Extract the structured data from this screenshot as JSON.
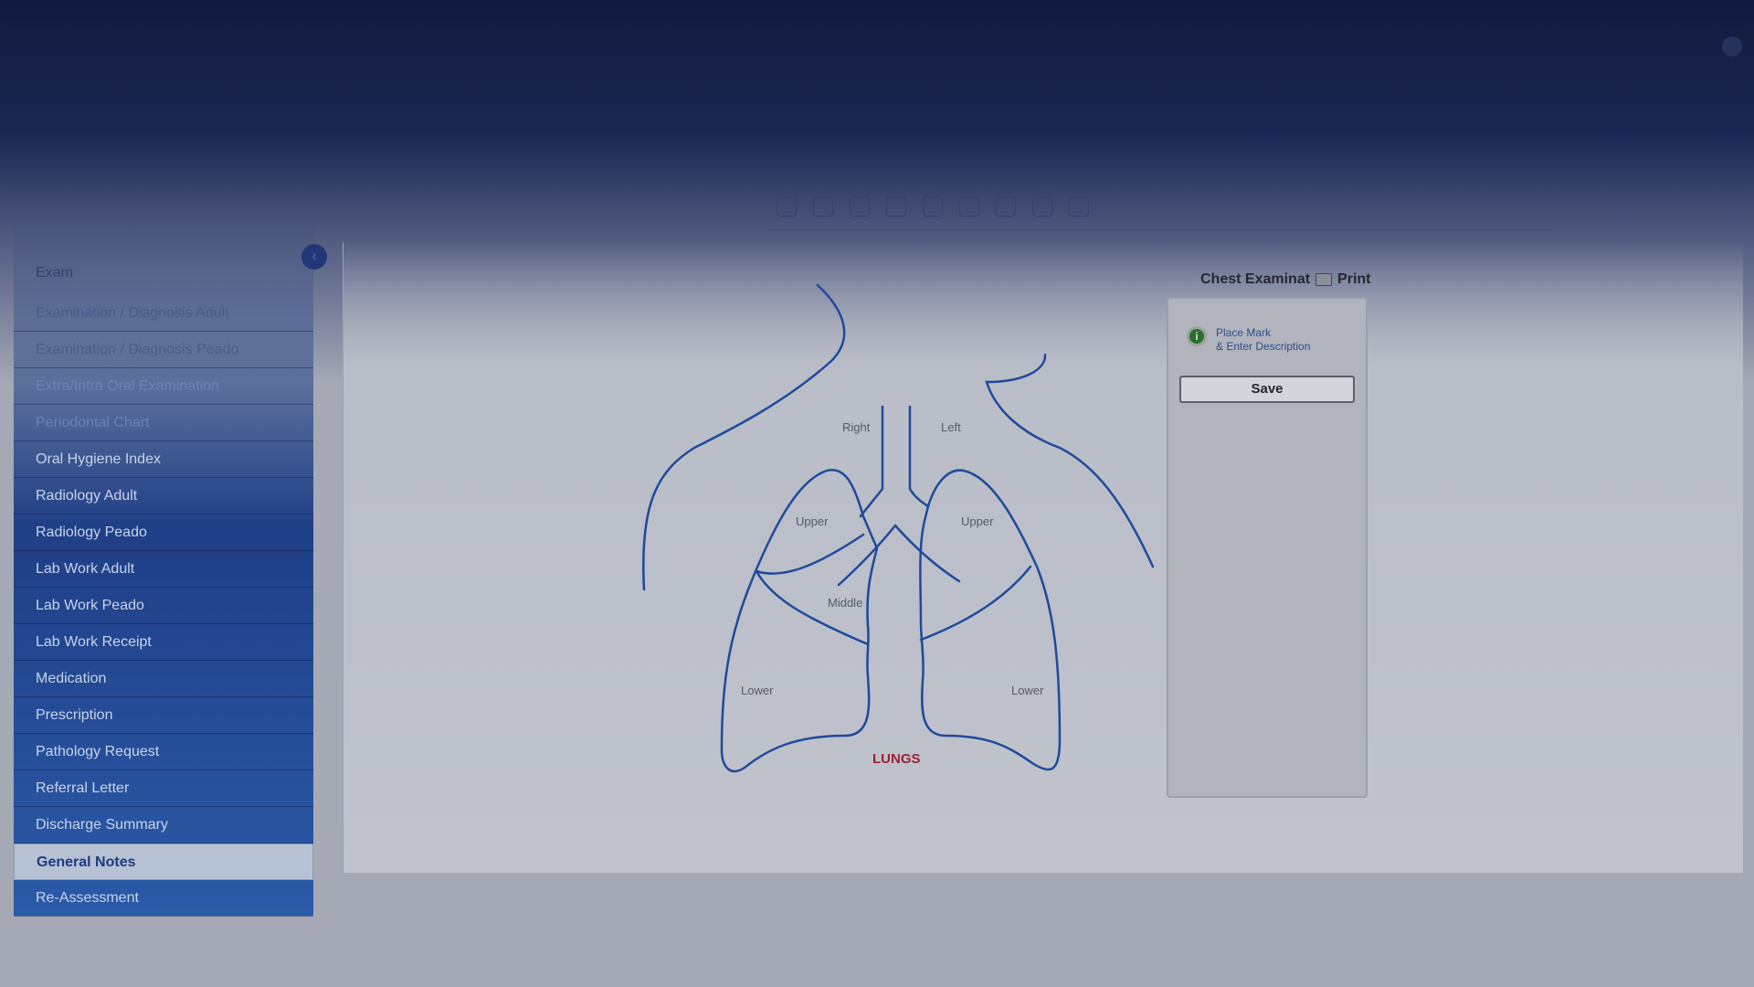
{
  "sidebar": {
    "header": "Exam",
    "items": [
      {
        "label": "Examination / Diagnosis Adult",
        "state": "faded"
      },
      {
        "label": "Examination / Diagnosis Peado",
        "state": "faded"
      },
      {
        "label": "Extra/Intra Oral Examination",
        "state": "faded2"
      },
      {
        "label": "Periodontal Chart",
        "state": "faded2"
      },
      {
        "label": "Oral Hygiene Index",
        "state": "normal"
      },
      {
        "label": "Radiology Adult",
        "state": "normal"
      },
      {
        "label": "Radiology Peado",
        "state": "normal"
      },
      {
        "label": "Lab Work Adult",
        "state": "normal"
      },
      {
        "label": "Lab Work Peado",
        "state": "normal"
      },
      {
        "label": "Lab Work Receipt",
        "state": "normal"
      },
      {
        "label": "Medication",
        "state": "normal"
      },
      {
        "label": "Prescription",
        "state": "normal"
      },
      {
        "label": "Pathology Request",
        "state": "normal"
      },
      {
        "label": "Referral Letter",
        "state": "normal"
      },
      {
        "label": "Discharge Summary",
        "state": "normal"
      },
      {
        "label": "General Notes",
        "state": "active"
      },
      {
        "label": "Re-Assessment",
        "state": "normal"
      }
    ]
  },
  "toolbar": {
    "tools": [
      {
        "icon": "vision-icon"
      },
      {
        "icon": "vision-icon"
      },
      {
        "icon": "vision-icon"
      },
      {
        "icon": "anterior-icon"
      },
      {
        "icon": "retina-icon"
      },
      {
        "icon": "eye-icon"
      },
      {
        "icon": "grid-icon"
      },
      {
        "icon": "dental-chart-icon"
      },
      {
        "icon": "globe-icon"
      }
    ]
  },
  "diagram": {
    "label_right": "Right",
    "label_left": "Left",
    "label_upper_right": "Upper",
    "label_upper_left": "Upper",
    "label_middle": "Middle",
    "label_lower_right": "Lower",
    "label_lower_left": "Lower",
    "caption": "LUNGS",
    "stroke_color": "#1f4a9a",
    "caption_color": "#9a2233"
  },
  "exam_panel": {
    "title": "Chest Examinat",
    "print_label": "Print",
    "hint_line1": "Place Mark",
    "hint_line2": "& Enter Description",
    "save_label": "Save"
  }
}
